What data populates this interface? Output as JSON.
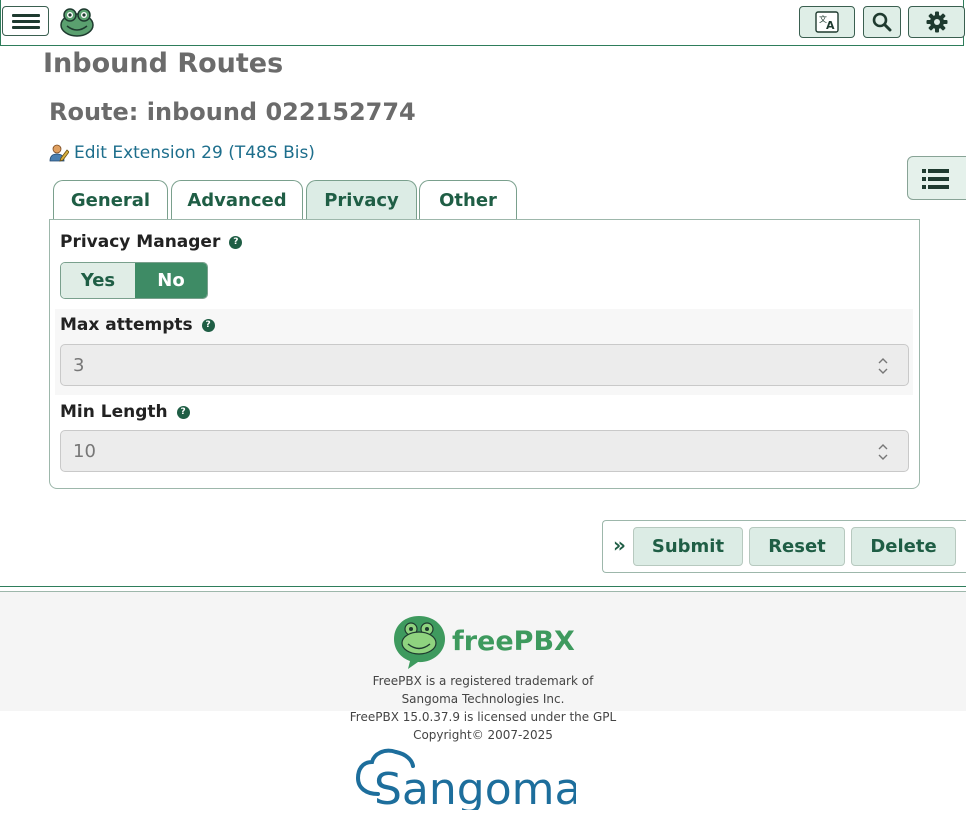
{
  "page": {
    "title": "Inbound Routes",
    "route_title": "Route: inbound 022152774",
    "edit_link": "Edit Extension 29 (T48S Bis)"
  },
  "tabs": [
    {
      "label": "General"
    },
    {
      "label": "Advanced"
    },
    {
      "label": "Privacy",
      "active": true
    },
    {
      "label": "Other"
    }
  ],
  "privacy": {
    "manager_label": "Privacy Manager",
    "manager_options": [
      "Yes",
      "No"
    ],
    "manager_selected": "No",
    "max_attempts_label": "Max attempts",
    "max_attempts_value": "3",
    "min_length_label": "Min Length",
    "min_length_value": "10"
  },
  "actions": {
    "submit": "Submit",
    "reset": "Reset",
    "delete": "Delete"
  },
  "footer": {
    "logo_text": "freePBX",
    "trademark_1": "FreePBX is a registered trademark of",
    "trademark_2": "Sangoma Technologies Inc.",
    "license": "FreePBX 15.0.37.9 is licensed under the GPL",
    "copyright": "Copyright© 2007-2025",
    "sangoma_logo_text": "Sangoma"
  },
  "icons": {
    "menu": "hamburger-icon",
    "logo": "frog-logo-icon",
    "language": "translate-icon",
    "search": "search-icon",
    "settings": "gear-icon",
    "side_list": "list-icon",
    "help": "question-circle-icon",
    "edit_user": "user-edit-icon"
  },
  "colors": {
    "brand_green": "#3e8b65",
    "dark_green": "#1f5e45",
    "link_blue": "#1d6e8c",
    "heading_gray": "#6b6b6b"
  }
}
